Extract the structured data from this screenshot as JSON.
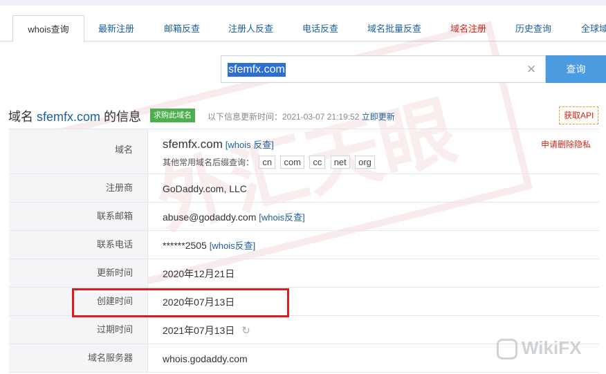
{
  "tabs": [
    {
      "label": "whois查询",
      "active": true
    },
    {
      "label": "最新注册"
    },
    {
      "label": "邮箱反查"
    },
    {
      "label": "注册人反查"
    },
    {
      "label": "电话反查"
    },
    {
      "label": "域名批量反查"
    },
    {
      "label": "域名注册",
      "color": "#d0261b"
    },
    {
      "label": "历史查询"
    },
    {
      "label": "全球域"
    }
  ],
  "search": {
    "value": "sfemfx.com",
    "button": "查询"
  },
  "heading": {
    "prefix": "域名",
    "domain": "sfemfx.com",
    "suffix": "的信息",
    "buy_badge": "求购此域名",
    "update_text": "以下信息更新时间：2021-03-07 21:19:52",
    "update_link": "立即更新",
    "api_button": "获取API"
  },
  "table": {
    "domain_row": {
      "label": "域名",
      "domain": "sfemfx.com",
      "whois_link": "[whois 反查]",
      "suffix_label": "其他常用域名后缀查询：",
      "suffixes": [
        "cn",
        "com",
        "cc",
        "net",
        "org"
      ],
      "privacy_link": "申请删除隐私"
    },
    "registrar": {
      "label": "注册商",
      "value": "GoDaddy.com, LLC"
    },
    "email": {
      "label": "联系邮箱",
      "value": "abuse@godaddy.com",
      "link": "[whois反查]"
    },
    "phone": {
      "label": "联系电话",
      "value": "******2505",
      "link": "[whois反查]"
    },
    "updated": {
      "label": "更新时间",
      "value": "2020年12月21日"
    },
    "created": {
      "label": "创建时间",
      "value": "2020年07月13日"
    },
    "expires": {
      "label": "过期时间",
      "value": "2021年07月13日"
    },
    "nameserver": {
      "label": "域名服务器",
      "value": "whois.godaddy.com"
    }
  },
  "watermark": {
    "brand": "WikiFX",
    "stamp_text": "外汇天眼"
  },
  "colors": {
    "link": "#1a5f9e",
    "accent_red": "#d0261b",
    "search_button": "#4a9be0",
    "badge_green": "#4cae4c",
    "highlight_box": "#e0181b"
  }
}
